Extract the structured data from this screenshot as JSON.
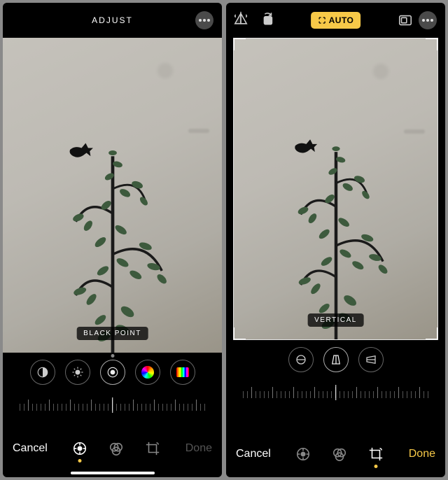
{
  "left": {
    "header": {
      "title": "ADJUST"
    },
    "param_badge": "BLACK POINT",
    "dials": [
      {
        "name": "contrast-dial"
      },
      {
        "name": "brightness-dial"
      },
      {
        "name": "black-point-dial"
      },
      {
        "name": "saturation-dial"
      },
      {
        "name": "vibrance-dial"
      }
    ],
    "footer": {
      "cancel": "Cancel",
      "done": "Done",
      "modes": [
        {
          "name": "adjust-mode",
          "active": true
        },
        {
          "name": "filters-mode",
          "active": false
        },
        {
          "name": "crop-mode",
          "active": false
        }
      ]
    }
  },
  "right": {
    "header": {
      "tools": [
        {
          "name": "flip-icon"
        },
        {
          "name": "rotate-icon"
        }
      ],
      "auto_label": "AUTO",
      "aspect_tool": "aspect-ratio-icon"
    },
    "param_badge": "VERTICAL",
    "dials": [
      {
        "name": "straighten-dial"
      },
      {
        "name": "vertical-perspective-dial"
      },
      {
        "name": "horizontal-perspective-dial"
      }
    ],
    "footer": {
      "cancel": "Cancel",
      "done": "Done",
      "modes": [
        {
          "name": "adjust-mode",
          "active": false
        },
        {
          "name": "filters-mode",
          "active": false
        },
        {
          "name": "crop-mode",
          "active": true
        }
      ]
    }
  }
}
